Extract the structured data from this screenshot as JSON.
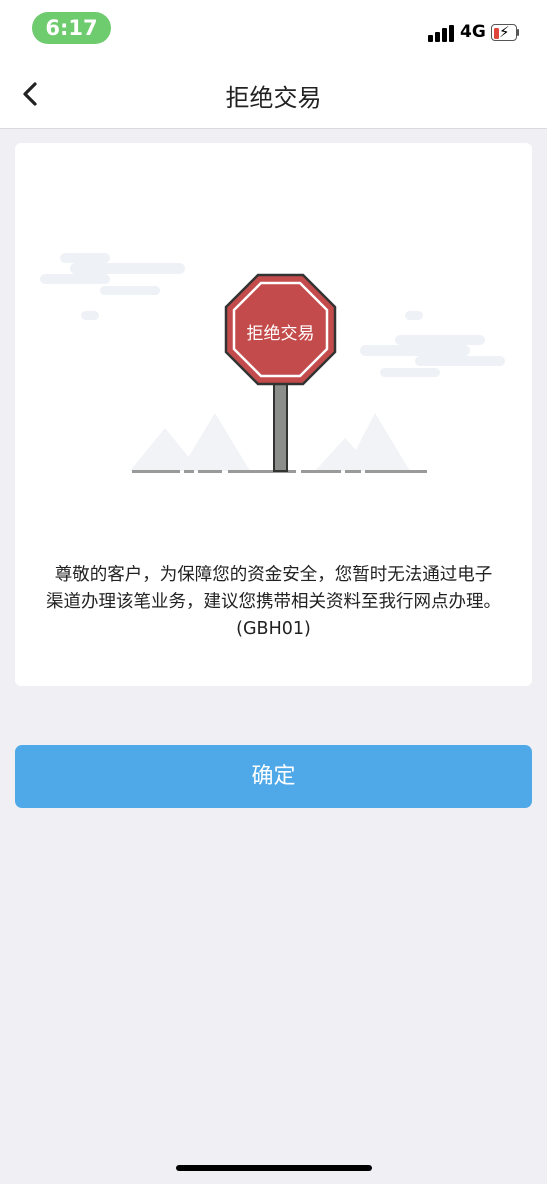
{
  "status_bar": {
    "time": "6:17",
    "network": "4G",
    "battery_level": 0.15,
    "colors": {
      "time_pill": "#6ecb6e",
      "battery_low": "#e0453c"
    }
  },
  "nav": {
    "back_icon": "chevron-left-icon",
    "title": "拒绝交易"
  },
  "card": {
    "sign_text": "拒绝交易",
    "message_lines": [
      "尊敬的客户，为保障您的资金安全，您暂时无法通过电子",
      "渠道办理该笔业务，建议您携带相关资料至我行网点办理。",
      "(GBH01)"
    ]
  },
  "confirm_button": {
    "label": "确定",
    "color": "#4fa9e8"
  },
  "colors": {
    "background": "#efeff4",
    "sign_red": "#c44b4b"
  }
}
